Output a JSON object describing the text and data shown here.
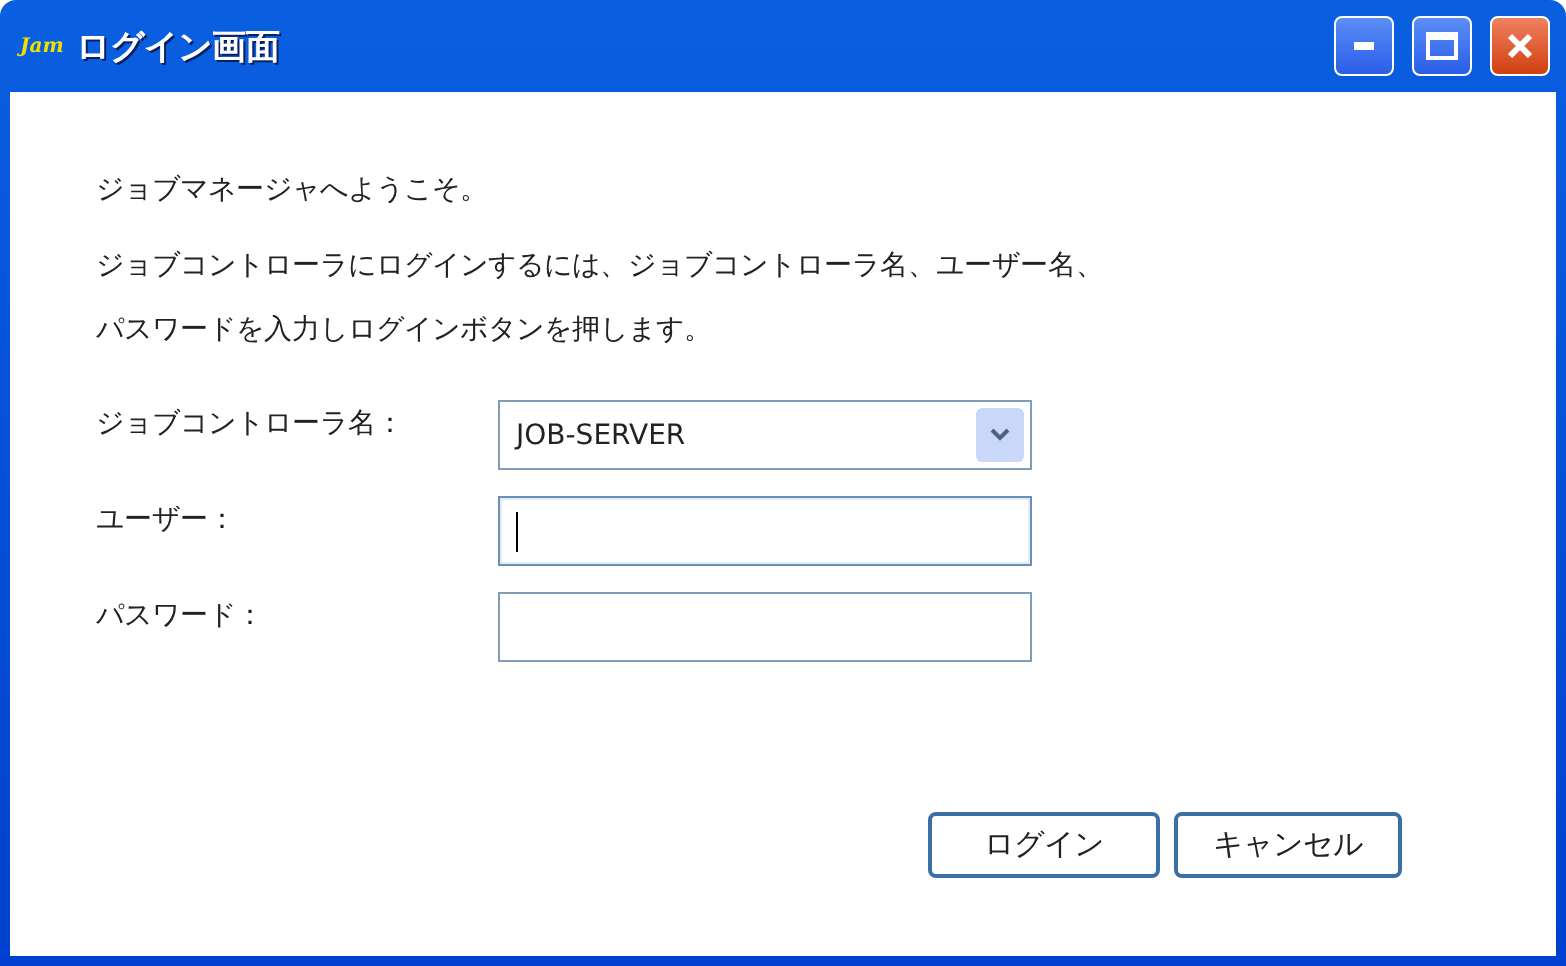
{
  "window": {
    "logo": "Jam",
    "title": "ログイン画面"
  },
  "paragraphs": [
    {
      "lines": [
        "ジョブマネージャへようこそ。"
      ]
    },
    {
      "lines": [
        "ジョブコントローラにログインするには、ジョブコントローラ名、ユーザー名、",
        "パスワードを入力しログインボタンを押します。"
      ]
    }
  ],
  "fields": [
    {
      "label": "ジョブコントローラ名：",
      "kind": "select",
      "value": "JOB-SERVER",
      "focused": false
    },
    {
      "label": "ユーザー：",
      "kind": "text",
      "focused": true
    },
    {
      "label": "パスワード：",
      "kind": "text",
      "focused": false
    }
  ],
  "buttons": [
    "ログイン",
    "キャンセル"
  ]
}
